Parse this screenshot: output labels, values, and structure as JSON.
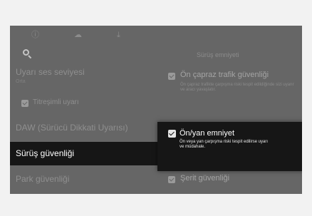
{
  "topbar": {
    "icons": [
      "info-icon",
      "cloud-icon",
      "download-icon"
    ],
    "glyphs": [
      "ⓘ",
      "☁",
      "⤓"
    ]
  },
  "search": {
    "icon": "search-icon"
  },
  "left_menu": {
    "items": [
      {
        "label": "Uyarı ses seviyesi",
        "sub": "Orta"
      },
      {
        "label": "Titreşimli uyarı",
        "checked": true
      },
      {
        "label": "DAW (Sürücü Dikkati Uyarısı)"
      },
      {
        "label": "Sürüş güvenliği",
        "selected": true
      },
      {
        "label": "Park güvenliği"
      }
    ]
  },
  "right_panel": {
    "title": "Sürüş emniyeti",
    "options": [
      {
        "label": "Ön çapraz trafik güvenliği",
        "checked": true,
        "desc": "Ön çapraz trafikte çarpışma riski tespit edildiğinde sizi uyarır ve aracı yavaşlatır."
      },
      {
        "label": "Ön/yan emniyet",
        "checked": true,
        "desc": "Ön veya yan çarpışma riski tespit edilirse uyarı ve müdahale."
      },
      {
        "label": "Şerit güvenliği",
        "checked": true
      }
    ]
  },
  "colors": {
    "screen_bg": "#666666",
    "selected_bg": "#161616",
    "text_dim": "#8f8f8f",
    "text_bright": "#ffffff"
  }
}
